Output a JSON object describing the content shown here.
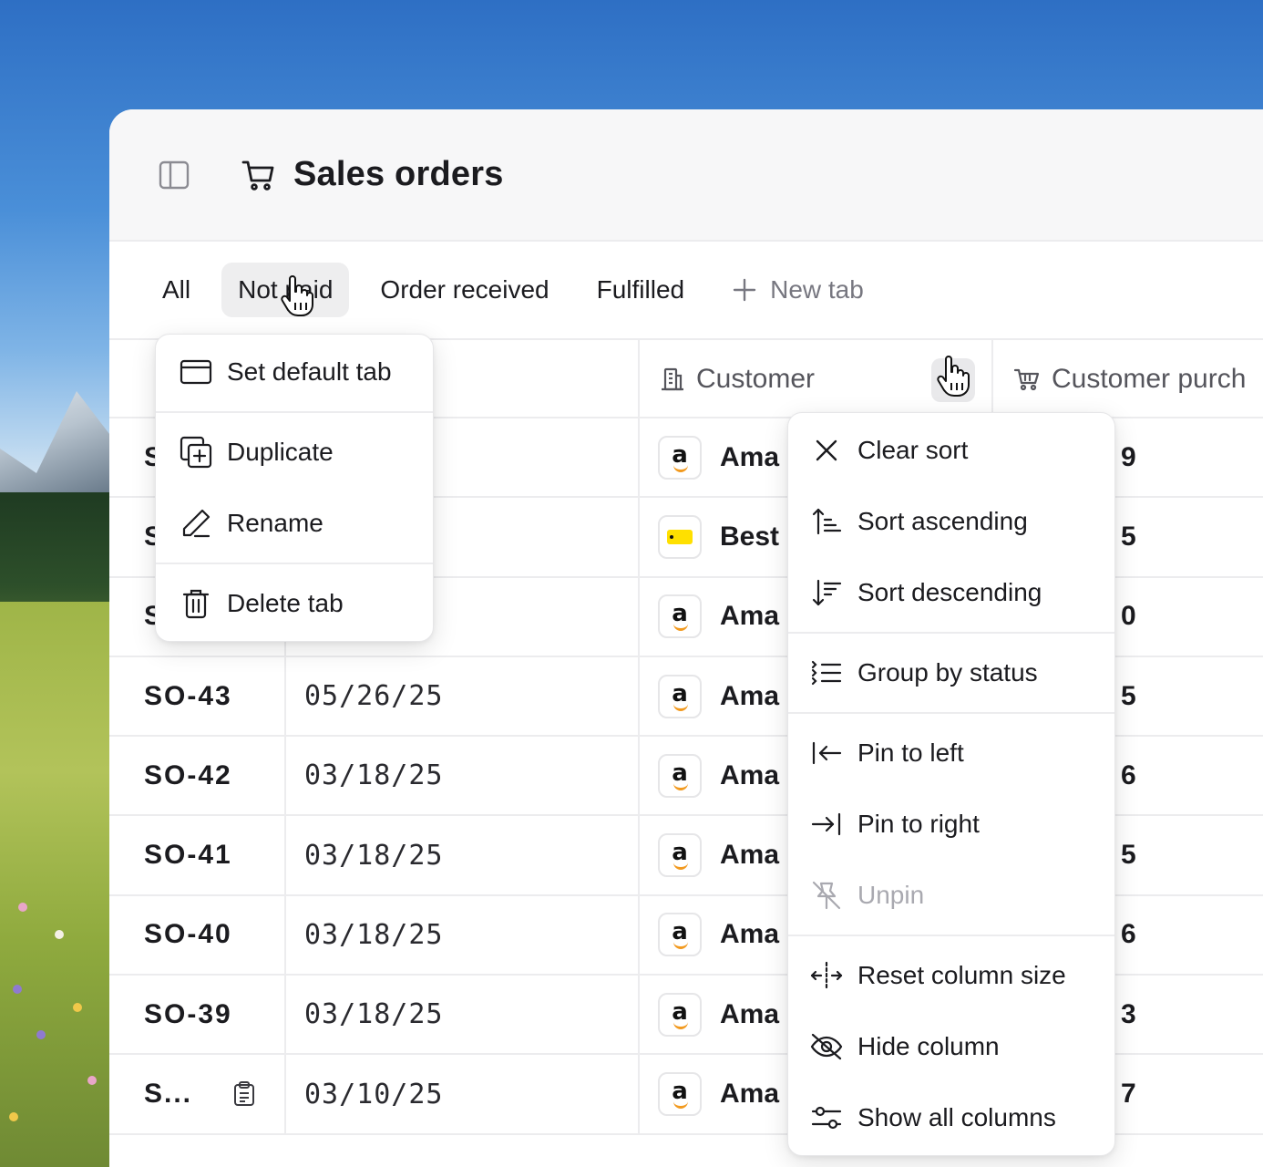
{
  "header": {
    "title": "Sales orders"
  },
  "tabs": [
    {
      "label": "All"
    },
    {
      "label": "Not paid"
    },
    {
      "label": "Order received"
    },
    {
      "label": "Fulfilled"
    }
  ],
  "new_tab_label": "New tab",
  "columns": {
    "customer": "Customer",
    "customer_purchase": "Customer purch"
  },
  "rows": [
    {
      "id": "S",
      "date": "",
      "customer": "Ama",
      "logo": "amazon",
      "purch": "9"
    },
    {
      "id": "S",
      "date": "",
      "customer": "Best",
      "logo": "bestbuy",
      "purch": "5"
    },
    {
      "id": "S",
      "date": "",
      "customer": "Ama",
      "logo": "amazon",
      "purch": "0"
    },
    {
      "id": "SO-43",
      "date": "05/26/25",
      "customer": "Ama",
      "logo": "amazon",
      "purch": "5"
    },
    {
      "id": "SO-42",
      "date": "03/18/25",
      "customer": "Ama",
      "logo": "amazon",
      "purch": "6"
    },
    {
      "id": "SO-41",
      "date": "03/18/25",
      "customer": "Ama",
      "logo": "amazon",
      "purch": "5"
    },
    {
      "id": "SO-40",
      "date": "03/18/25",
      "customer": "Ama",
      "logo": "amazon",
      "purch": "6"
    },
    {
      "id": "SO-39",
      "date": "03/18/25",
      "customer": "Ama",
      "logo": "amazon",
      "purch": "3"
    },
    {
      "id": "S...",
      "date": "03/10/25",
      "customer": "Ama",
      "logo": "amazon",
      "purch": "7"
    }
  ],
  "tab_menu": {
    "set_default": "Set default tab",
    "duplicate": "Duplicate",
    "rename": "Rename",
    "delete": "Delete tab"
  },
  "column_menu": {
    "clear_sort": "Clear sort",
    "sort_asc": "Sort ascending",
    "sort_desc": "Sort descending",
    "group_by_status": "Group by status",
    "pin_left": "Pin to left",
    "pin_right": "Pin to right",
    "unpin": "Unpin",
    "reset_size": "Reset column size",
    "hide_column": "Hide column",
    "show_all": "Show all columns"
  },
  "icons": [
    "sidebar-toggle-icon",
    "cart-icon",
    "plus-icon",
    "building-icon",
    "cart-handle-icon",
    "calendar-icon",
    "duplicate-icon",
    "pencil-icon",
    "trash-icon",
    "close-icon",
    "sort-ascending-icon",
    "sort-descending-icon",
    "group-list-icon",
    "pin-left-icon",
    "pin-right-icon",
    "unpin-icon",
    "resize-icon",
    "eye-off-icon",
    "sliders-icon",
    "clipboard-icon",
    "hand-cursor-icon"
  ],
  "colors": {
    "amazon_smile": "#f29a1f",
    "bestbuy_tag": "#ffe000",
    "active_tab_bg": "#eeeeef"
  }
}
